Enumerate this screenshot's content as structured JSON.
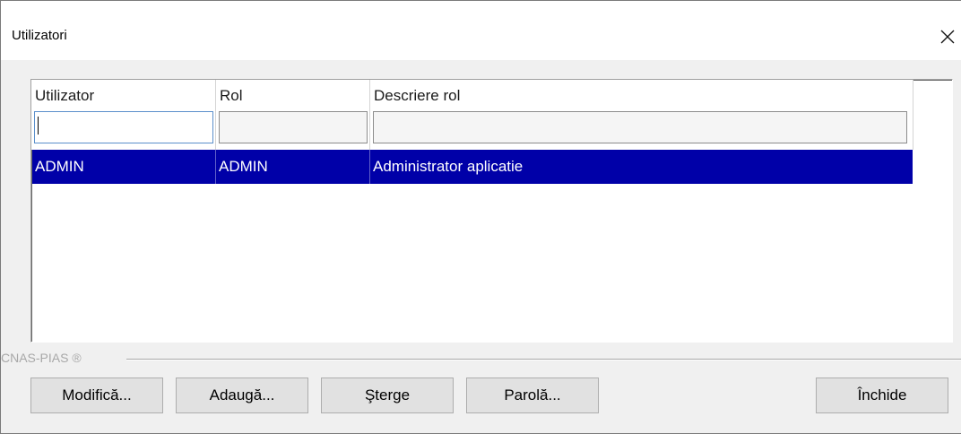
{
  "window": {
    "title": "Utilizatori"
  },
  "icons": {
    "close": "close-icon"
  },
  "grid": {
    "columns": [
      {
        "label": "Utilizator",
        "filter_value": ""
      },
      {
        "label": "Rol",
        "filter_value": ""
      },
      {
        "label": "Descriere rol",
        "filter_value": ""
      }
    ],
    "rows": [
      {
        "utilizator": "ADMIN",
        "rol": "ADMIN",
        "descriere": "Administrator aplicatie",
        "selected": true
      }
    ]
  },
  "group": {
    "label": "CNAS-PIAS ®"
  },
  "buttons": {
    "modifica": "Modifică...",
    "adauga": "Adaugă...",
    "sterge": "Şterge",
    "parola": "Parolă...",
    "inchide": "Închide"
  },
  "colors": {
    "selection": "#0000a8",
    "selection_text": "#ffffff",
    "dialog_bg": "#f0f0f0"
  }
}
